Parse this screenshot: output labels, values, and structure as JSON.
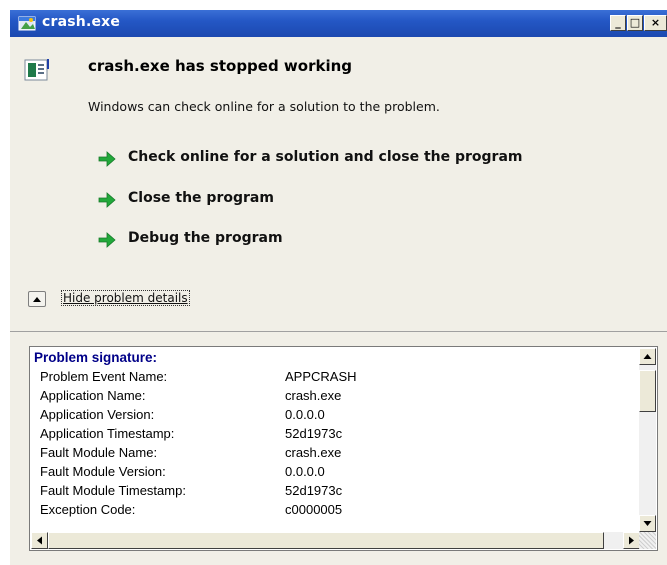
{
  "window": {
    "title": "crash.exe",
    "controls": {
      "minimize": "_",
      "maximize": "□",
      "close": "×"
    }
  },
  "dialog": {
    "heading": "crash.exe has stopped working",
    "description": "Windows can check online for a solution to the problem.",
    "actions": [
      {
        "label": "Check online for a solution and close the program",
        "icon": "green-arrow-icon"
      },
      {
        "label": "Close the program",
        "icon": "green-arrow-icon"
      },
      {
        "label": "Debug the program",
        "icon": "green-arrow-icon"
      }
    ],
    "details_toggle": {
      "label": "Hide problem details",
      "icon": "collapse-up-icon"
    }
  },
  "details": {
    "title": "Problem signature:",
    "rows": [
      {
        "key": "Problem Event Name:",
        "value": "APPCRASH"
      },
      {
        "key": "Application Name:",
        "value": "crash.exe"
      },
      {
        "key": "Application Version:",
        "value": "0.0.0.0"
      },
      {
        "key": "Application Timestamp:",
        "value": "52d1973c"
      },
      {
        "key": "Fault Module Name:",
        "value": "crash.exe"
      },
      {
        "key": "Fault Module Version:",
        "value": "0.0.0.0"
      },
      {
        "key": "Fault Module Timestamp:",
        "value": "52d1973c"
      },
      {
        "key": "Exception Code:",
        "value": "c0000005"
      }
    ]
  },
  "colors": {
    "titlebar": "#2457c5",
    "signature_title": "#000088",
    "action_arrow": "#22a83a"
  }
}
